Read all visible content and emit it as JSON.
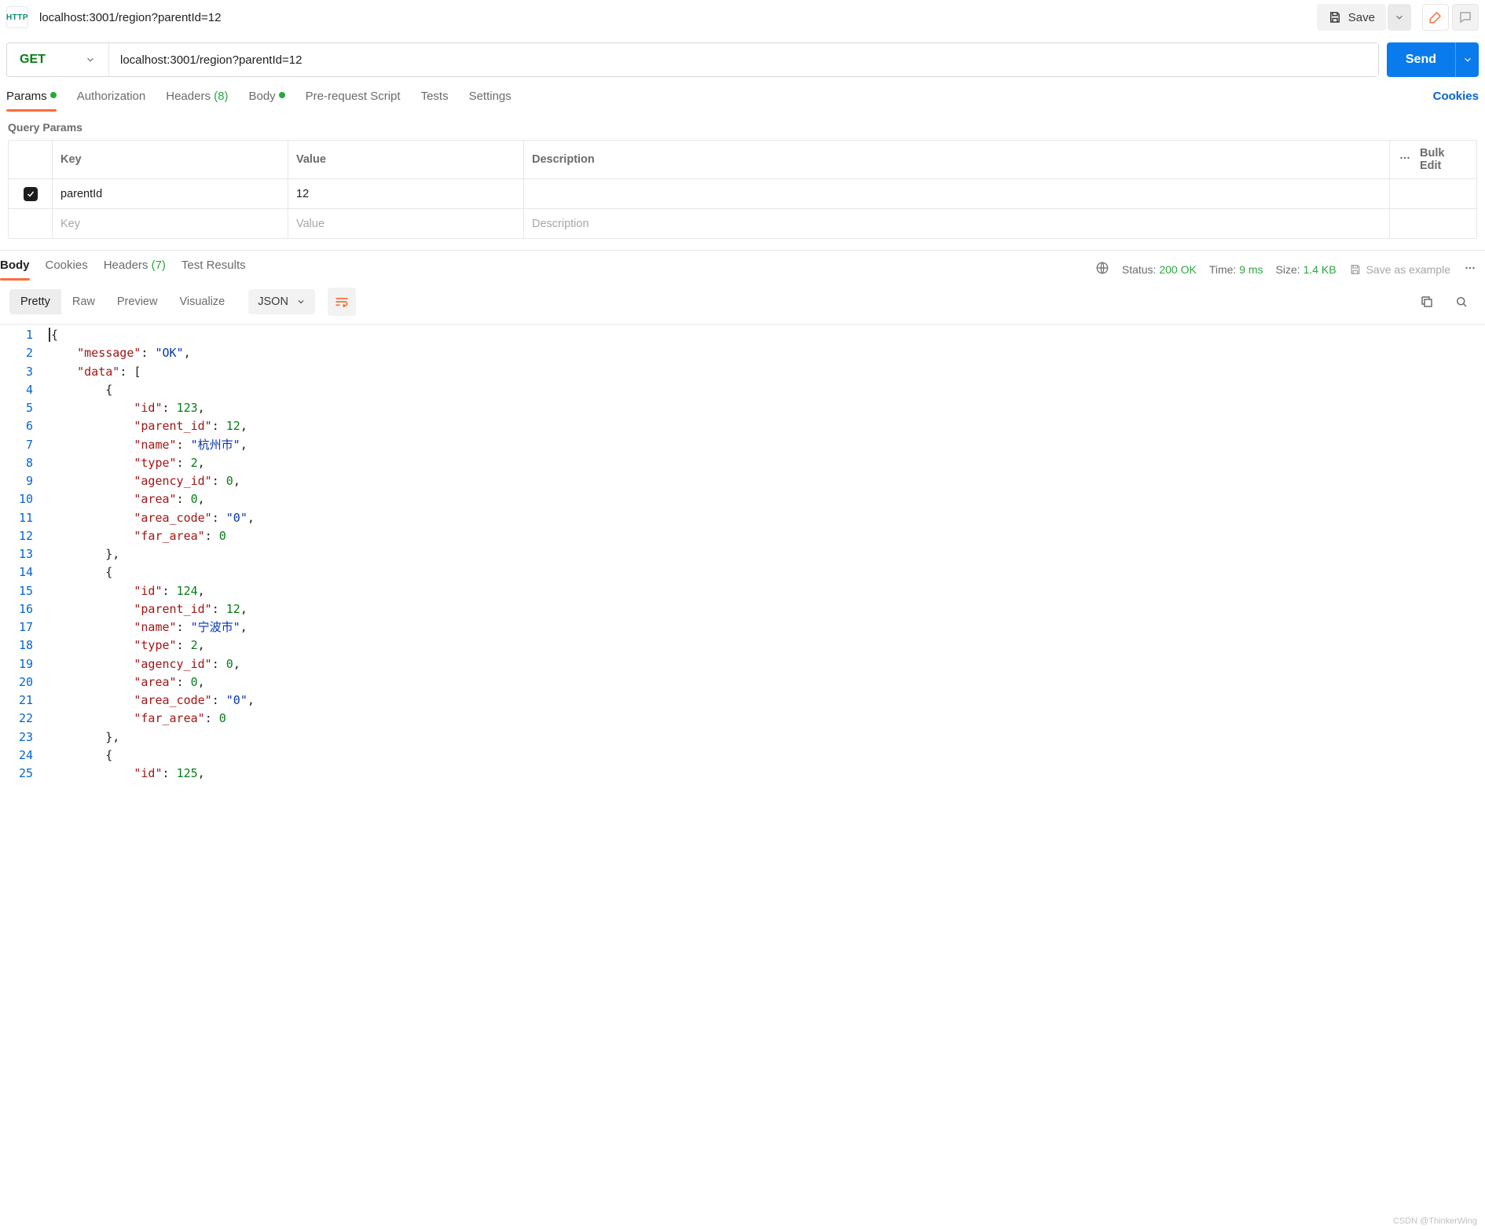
{
  "tab": {
    "icon_label": "HTTP",
    "title": "localhost:3001/region?parentId=12"
  },
  "toolbar": {
    "save": "Save"
  },
  "request": {
    "method": "GET",
    "url": "localhost:3001/region?parentId=12",
    "send": "Send"
  },
  "req_tabs": {
    "params": "Params",
    "auth": "Authorization",
    "headers_label": "Headers",
    "headers_count": "(8)",
    "body": "Body",
    "prerequest": "Pre-request Script",
    "tests": "Tests",
    "settings": "Settings",
    "cookies": "Cookies"
  },
  "query_params": {
    "label": "Query Params",
    "cols": {
      "key": "Key",
      "value": "Value",
      "desc": "Description",
      "bulk": "Bulk Edit"
    },
    "rows": [
      {
        "checked": true,
        "key": "parentId",
        "value": "12",
        "desc": ""
      }
    ],
    "placeholders": {
      "key": "Key",
      "value": "Value",
      "desc": "Description"
    }
  },
  "resp_tabs": {
    "body": "Body",
    "cookies": "Cookies",
    "headers_label": "Headers",
    "headers_count": "(7)",
    "tests": "Test Results"
  },
  "meta": {
    "status_label": "Status:",
    "status_value": "200 OK",
    "time_label": "Time:",
    "time_value": "9 ms",
    "size_label": "Size:",
    "size_value": "1.4 KB",
    "save_example": "Save as example"
  },
  "view": {
    "pretty": "Pretty",
    "raw": "Raw",
    "preview": "Preview",
    "visualize": "Visualize",
    "type": "JSON"
  },
  "code_lines": [
    [
      [
        "cursor",
        ""
      ],
      [
        "punc",
        "{"
      ]
    ],
    [
      [
        "indent",
        1
      ],
      [
        "key",
        "\"message\""
      ],
      [
        "punc",
        ": "
      ],
      [
        "str",
        "\"OK\""
      ],
      [
        "punc",
        ","
      ]
    ],
    [
      [
        "indent",
        1
      ],
      [
        "key",
        "\"data\""
      ],
      [
        "punc",
        ": ["
      ]
    ],
    [
      [
        "indent",
        2
      ],
      [
        "punc",
        "{"
      ]
    ],
    [
      [
        "indent",
        3
      ],
      [
        "key",
        "\"id\""
      ],
      [
        "punc",
        ": "
      ],
      [
        "num",
        "123"
      ],
      [
        "punc",
        ","
      ]
    ],
    [
      [
        "indent",
        3
      ],
      [
        "key",
        "\"parent_id\""
      ],
      [
        "punc",
        ": "
      ],
      [
        "num",
        "12"
      ],
      [
        "punc",
        ","
      ]
    ],
    [
      [
        "indent",
        3
      ],
      [
        "key",
        "\"name\""
      ],
      [
        "punc",
        ": "
      ],
      [
        "str",
        "\"杭州市\""
      ],
      [
        "punc",
        ","
      ]
    ],
    [
      [
        "indent",
        3
      ],
      [
        "key",
        "\"type\""
      ],
      [
        "punc",
        ": "
      ],
      [
        "num",
        "2"
      ],
      [
        "punc",
        ","
      ]
    ],
    [
      [
        "indent",
        3
      ],
      [
        "key",
        "\"agency_id\""
      ],
      [
        "punc",
        ": "
      ],
      [
        "num",
        "0"
      ],
      [
        "punc",
        ","
      ]
    ],
    [
      [
        "indent",
        3
      ],
      [
        "key",
        "\"area\""
      ],
      [
        "punc",
        ": "
      ],
      [
        "num",
        "0"
      ],
      [
        "punc",
        ","
      ]
    ],
    [
      [
        "indent",
        3
      ],
      [
        "key",
        "\"area_code\""
      ],
      [
        "punc",
        ": "
      ],
      [
        "str",
        "\"0\""
      ],
      [
        "punc",
        ","
      ]
    ],
    [
      [
        "indent",
        3
      ],
      [
        "key",
        "\"far_area\""
      ],
      [
        "punc",
        ": "
      ],
      [
        "num",
        "0"
      ]
    ],
    [
      [
        "indent",
        2
      ],
      [
        "punc",
        "},"
      ]
    ],
    [
      [
        "indent",
        2
      ],
      [
        "punc",
        "{"
      ]
    ],
    [
      [
        "indent",
        3
      ],
      [
        "key",
        "\"id\""
      ],
      [
        "punc",
        ": "
      ],
      [
        "num",
        "124"
      ],
      [
        "punc",
        ","
      ]
    ],
    [
      [
        "indent",
        3
      ],
      [
        "key",
        "\"parent_id\""
      ],
      [
        "punc",
        ": "
      ],
      [
        "num",
        "12"
      ],
      [
        "punc",
        ","
      ]
    ],
    [
      [
        "indent",
        3
      ],
      [
        "key",
        "\"name\""
      ],
      [
        "punc",
        ": "
      ],
      [
        "str",
        "\"宁波市\""
      ],
      [
        "punc",
        ","
      ]
    ],
    [
      [
        "indent",
        3
      ],
      [
        "key",
        "\"type\""
      ],
      [
        "punc",
        ": "
      ],
      [
        "num",
        "2"
      ],
      [
        "punc",
        ","
      ]
    ],
    [
      [
        "indent",
        3
      ],
      [
        "key",
        "\"agency_id\""
      ],
      [
        "punc",
        ": "
      ],
      [
        "num",
        "0"
      ],
      [
        "punc",
        ","
      ]
    ],
    [
      [
        "indent",
        3
      ],
      [
        "key",
        "\"area\""
      ],
      [
        "punc",
        ": "
      ],
      [
        "num",
        "0"
      ],
      [
        "punc",
        ","
      ]
    ],
    [
      [
        "indent",
        3
      ],
      [
        "key",
        "\"area_code\""
      ],
      [
        "punc",
        ": "
      ],
      [
        "str",
        "\"0\""
      ],
      [
        "punc",
        ","
      ]
    ],
    [
      [
        "indent",
        3
      ],
      [
        "key",
        "\"far_area\""
      ],
      [
        "punc",
        ": "
      ],
      [
        "num",
        "0"
      ]
    ],
    [
      [
        "indent",
        2
      ],
      [
        "punc",
        "},"
      ]
    ],
    [
      [
        "indent",
        2
      ],
      [
        "punc",
        "{"
      ]
    ],
    [
      [
        "indent",
        3
      ],
      [
        "key",
        "\"id\""
      ],
      [
        "punc",
        ": "
      ],
      [
        "num",
        "125"
      ],
      [
        "punc",
        ","
      ]
    ]
  ],
  "watermark": "CSDN @ThinkerWing"
}
